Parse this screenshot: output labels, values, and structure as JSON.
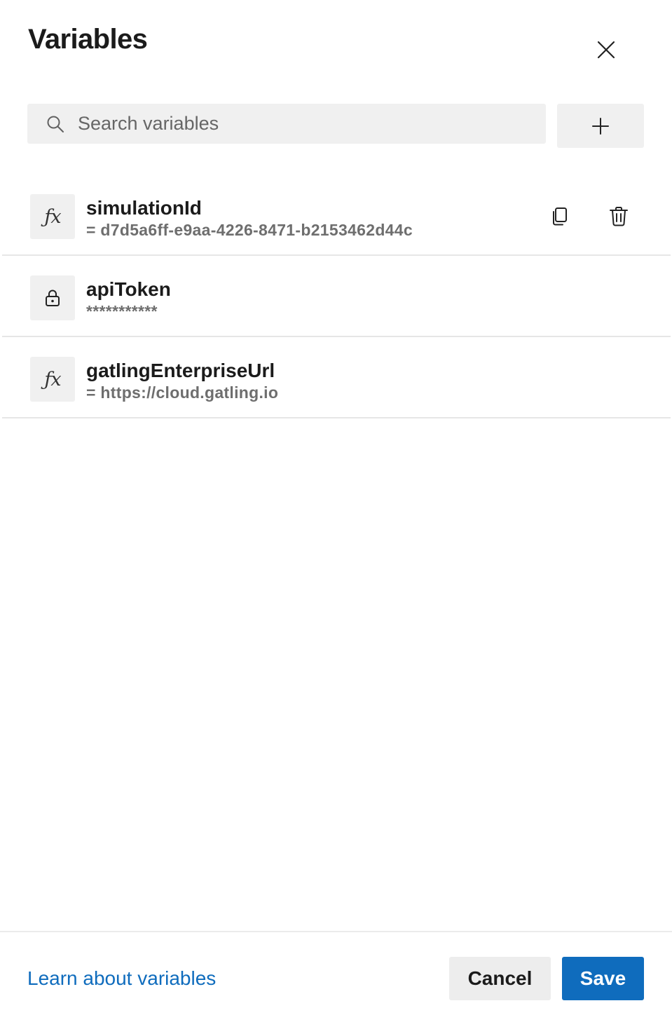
{
  "dialog": {
    "title": "Variables",
    "close_icon": "close-icon"
  },
  "search": {
    "placeholder": "Search variables",
    "value": "",
    "icon": "search-icon"
  },
  "add_button": {
    "icon": "plus-icon"
  },
  "variables": [
    {
      "name": "simulationId",
      "value": "= d7d5a6ff-e9aa-4226-8471-b2153462d44c",
      "kind": "fx-icon",
      "selected": true
    },
    {
      "name": "apiToken",
      "value": "***********",
      "kind": "lock-icon",
      "selected": false
    },
    {
      "name": "gatlingEnterpriseUrl",
      "value": "= https://cloud.gatling.io",
      "kind": "fx-icon",
      "selected": false
    }
  ],
  "row_actions": {
    "copy_icon": "copy-icon",
    "delete_icon": "trash-icon"
  },
  "footer": {
    "learn_link": "Learn about variables",
    "cancel_label": "Cancel",
    "save_label": "Save"
  },
  "colors": {
    "accent": "#0f6cbd",
    "neutral_bg": "#f0f0f0",
    "secondary_text": "#6e6e6e"
  }
}
